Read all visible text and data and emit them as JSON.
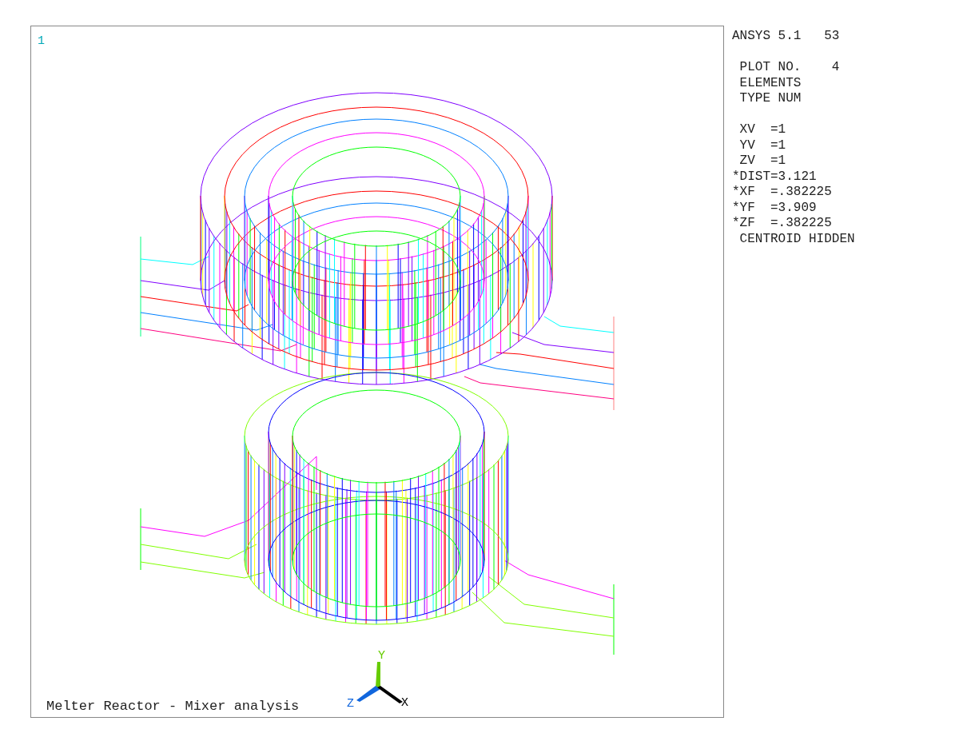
{
  "window_number": "1",
  "info": {
    "header": "ANSYS 5.1   53",
    "blocks": [
      [
        " PLOT NO.    4",
        " ELEMENTS",
        " TYPE NUM"
      ],
      [
        " XV  =1",
        " YV  =1",
        " ZV  =1",
        "*DIST=3.121",
        "*XF  =.382225",
        "*YF  =3.909",
        "*ZF  =.382225",
        " CENTROID HIDDEN"
      ]
    ]
  },
  "caption": "Melter Reactor - Mixer analysis",
  "axis_labels": {
    "x": "X",
    "y": "Y",
    "z": "Z"
  }
}
